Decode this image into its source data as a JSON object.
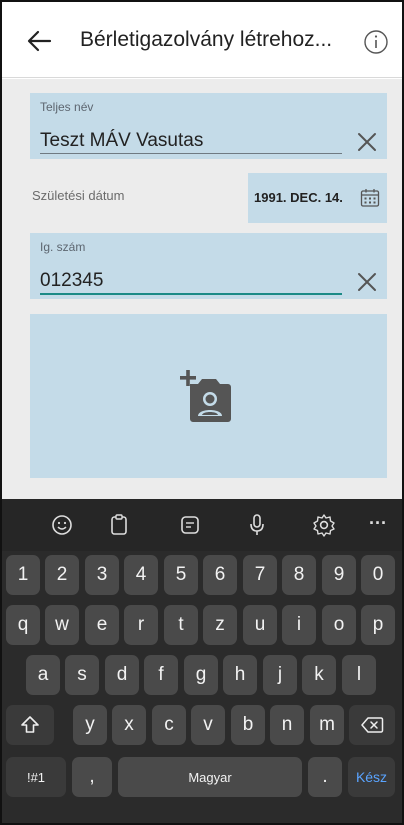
{
  "appbar": {
    "title": "Bérletigazolvány létrehoz..."
  },
  "form": {
    "full_name": {
      "label": "Teljes név",
      "value": "Teszt MÁV Vasutas"
    },
    "birth_date": {
      "label": "Születési dátum",
      "value": "1991. DEC. 14."
    },
    "id_number": {
      "label": "Ig. szám",
      "value": "012345"
    }
  },
  "keyboard": {
    "row_numbers": [
      "1",
      "2",
      "3",
      "4",
      "5",
      "6",
      "7",
      "8",
      "9",
      "0"
    ],
    "row_top": [
      "q",
      "w",
      "e",
      "r",
      "t",
      "z",
      "u",
      "i",
      "o",
      "p"
    ],
    "row_middle": [
      "a",
      "s",
      "d",
      "f",
      "g",
      "h",
      "j",
      "k",
      "l"
    ],
    "row_bottom": [
      "y",
      "x",
      "c",
      "v",
      "b",
      "n",
      "m"
    ],
    "symbols_key": "!#1",
    "comma_key": ",",
    "space_label": "Magyar",
    "period_key": ".",
    "done_key": "Kész",
    "toolbar_more": "···"
  },
  "colors": {
    "field_bg": "#c4dbe8",
    "accent": "#1b8a86",
    "keyboard_bg": "#2b2b2b",
    "key_bg": "#4a4a4a",
    "done": "#5aa4ff"
  },
  "icons": [
    "back-arrow-icon",
    "info-icon",
    "clear-icon",
    "calendar-icon",
    "add-photo-icon",
    "emoji-icon",
    "clipboard-icon",
    "sticker-icon",
    "mic-icon",
    "settings-icon",
    "more-icon",
    "shift-icon",
    "backspace-icon"
  ]
}
